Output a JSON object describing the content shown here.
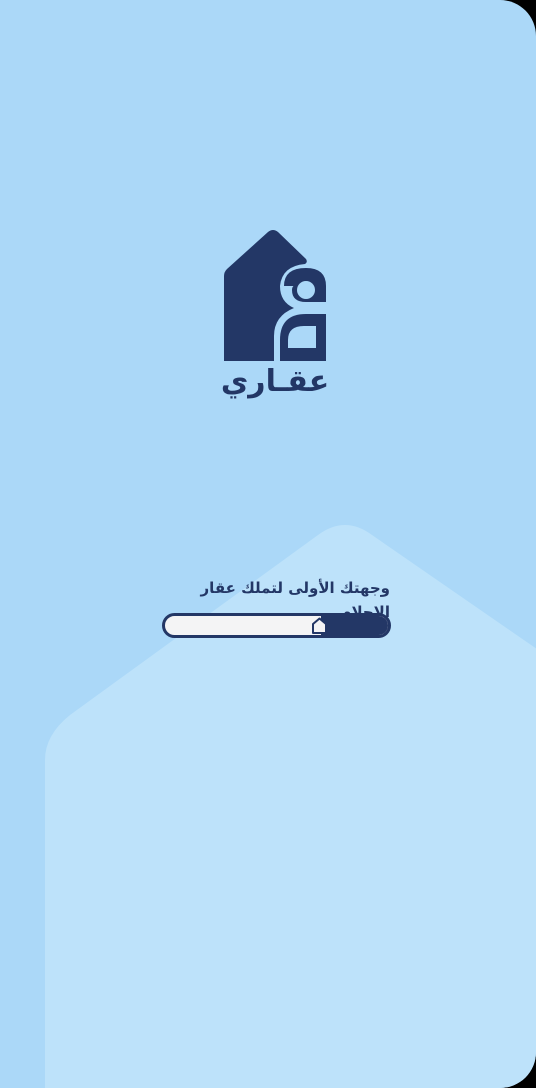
{
  "app": {
    "brand_name": "عقـاري",
    "tagline": "وجهتك الأولى لتملك عقار الاحلام",
    "logo_icon": "house-logo-icon"
  },
  "loading": {
    "progress_percent": 30,
    "marker_icon": "house-marker-icon"
  },
  "colors": {
    "background": "#abd8f8",
    "background_house": "#bde2fa",
    "brand_navy": "#233766",
    "track": "#f4f4f5"
  }
}
